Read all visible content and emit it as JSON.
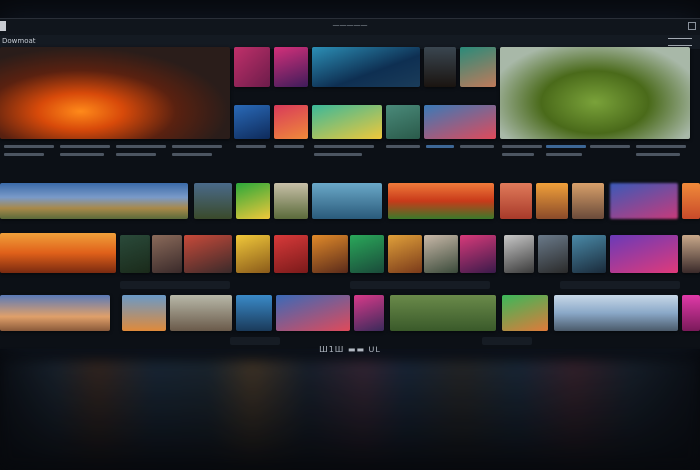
{
  "window": {
    "title": "—————"
  },
  "menubar": {
    "label": "Dowmoat"
  },
  "status": {
    "text": "Ш1Ш ▬▬ ᑌᒪ"
  },
  "colors": {
    "accent": "#4a7db7",
    "panel": "#0f141b",
    "background": "#07090d"
  },
  "icons": [
    "app-logo-icon",
    "window-controls-icon",
    "menu-icon"
  ]
}
